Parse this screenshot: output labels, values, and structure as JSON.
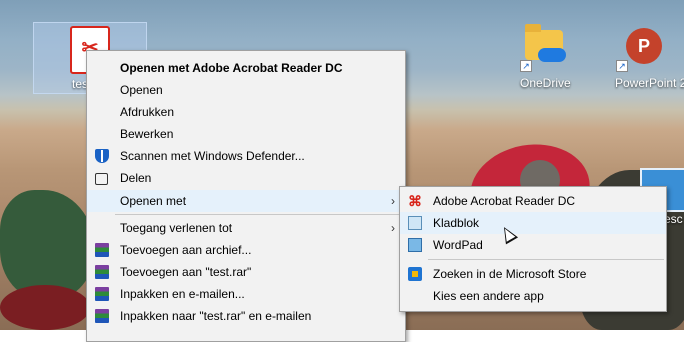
{
  "desktop": {
    "icons": {
      "pdf_label": "tes",
      "onedrive_label": "OneDrive",
      "powerpoint_label": "PowerPoint 2",
      "partial_label": "esc"
    }
  },
  "context_menu": {
    "items": [
      {
        "label": "Openen met Adobe Acrobat Reader DC",
        "icon": "none"
      },
      {
        "label": "Openen",
        "icon": "none"
      },
      {
        "label": "Afdrukken",
        "icon": "none"
      },
      {
        "label": "Bewerken",
        "icon": "none"
      },
      {
        "label": "Scannen met Windows Defender...",
        "icon": "defender-icon"
      },
      {
        "label": "Delen",
        "icon": "share-icon"
      },
      {
        "label": "Openen met",
        "icon": "none"
      },
      {
        "label": "Toegang verlenen tot",
        "icon": "none"
      },
      {
        "label": "Toevoegen aan archief...",
        "icon": "winrar-icon"
      },
      {
        "label": "Toevoegen aan \"test.rar\"",
        "icon": "winrar-icon"
      },
      {
        "label": "Inpakken en e-mailen...",
        "icon": "winrar-icon"
      },
      {
        "label": "Inpakken naar \"test.rar\" en e-mailen",
        "icon": "winrar-icon"
      }
    ],
    "submenu_arrow": "›"
  },
  "open_with_submenu": {
    "items": [
      {
        "label": "Adobe Acrobat Reader DC",
        "icon": "acrobat-icon"
      },
      {
        "label": "Kladblok",
        "icon": "notepad-icon"
      },
      {
        "label": "WordPad",
        "icon": "wordpad-icon"
      },
      {
        "label": "Zoeken in de Microsoft Store",
        "icon": "store-icon"
      },
      {
        "label": "Kies een andere app",
        "icon": "none"
      }
    ]
  },
  "colors": {
    "menu_bg": "#f2f2f2",
    "hover": "#91c9f7",
    "hover_light": "#e5f1fb"
  }
}
